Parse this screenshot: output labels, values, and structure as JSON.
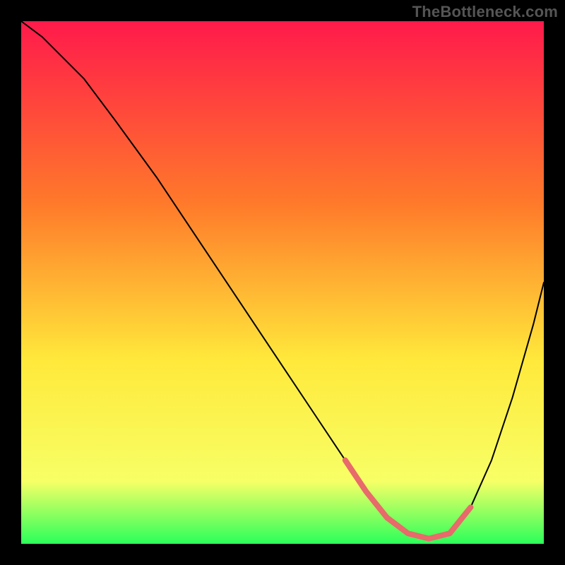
{
  "watermark": "TheBottleneck.com",
  "chart_data": {
    "type": "line",
    "title": "",
    "xlabel": "",
    "ylabel": "",
    "xlim": [
      0,
      100
    ],
    "ylim": [
      0,
      100
    ],
    "grid": false,
    "legend": false,
    "gradient_stops": [
      {
        "offset": 0,
        "color": "#ff1a4b"
      },
      {
        "offset": 0.35,
        "color": "#ff7a2a"
      },
      {
        "offset": 0.65,
        "color": "#ffe93b"
      },
      {
        "offset": 0.88,
        "color": "#f7ff66"
      },
      {
        "offset": 1.0,
        "color": "#2bff5a"
      }
    ],
    "series": [
      {
        "name": "bottleneck-curve",
        "color": "#000000",
        "width": 2,
        "x": [
          0,
          4,
          8,
          12,
          18,
          26,
          34,
          42,
          50,
          56,
          62,
          66,
          70,
          74,
          78,
          82,
          86,
          90,
          94,
          98,
          100
        ],
        "y": [
          100,
          97,
          93,
          89,
          81,
          70,
          58,
          46,
          34,
          25,
          16,
          10,
          5,
          2,
          1,
          2,
          7,
          16,
          28,
          42,
          50
        ]
      },
      {
        "name": "highlight-band",
        "color": "#e86a6a",
        "width": 8,
        "x": [
          62,
          66,
          70,
          74,
          78,
          82,
          86
        ],
        "y": [
          16,
          10,
          5,
          2,
          1,
          2,
          7
        ]
      }
    ]
  }
}
